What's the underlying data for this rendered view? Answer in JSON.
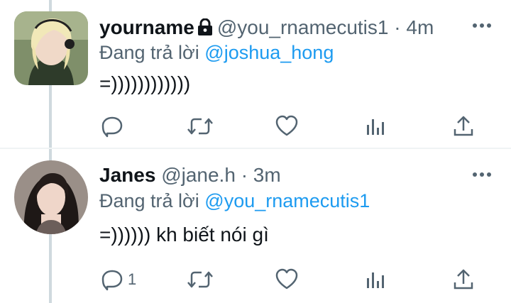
{
  "tweets": [
    {
      "name": "yourname",
      "handle": "@you_rnamecutis1",
      "dot": "·",
      "time": "4m",
      "protected": true,
      "reply_prefix": "Đang trả lời",
      "reply_to": "@joshua_hong",
      "text": "=))))))))))))",
      "reply_count": "",
      "icons": [
        "lock-icon",
        "more-icon",
        "reply-icon",
        "retweet-icon",
        "like-icon",
        "views-icon",
        "share-icon"
      ]
    },
    {
      "name": "Janes",
      "handle": "@jane.h",
      "dot": "·",
      "time": "3m",
      "protected": false,
      "reply_prefix": "Đang trả lời",
      "reply_to": "@you_rnamecutis1",
      "text": "=)))))) kh biết nói gì",
      "reply_count": "1",
      "icons": [
        "more-icon",
        "reply-icon",
        "retweet-icon",
        "like-icon",
        "views-icon",
        "share-icon"
      ]
    }
  ],
  "colors": {
    "text": "#0f1419",
    "secondary": "#536471",
    "accent": "#1d9bf0",
    "thread_line": "#cfd9de",
    "divider": "#eff3f4"
  }
}
